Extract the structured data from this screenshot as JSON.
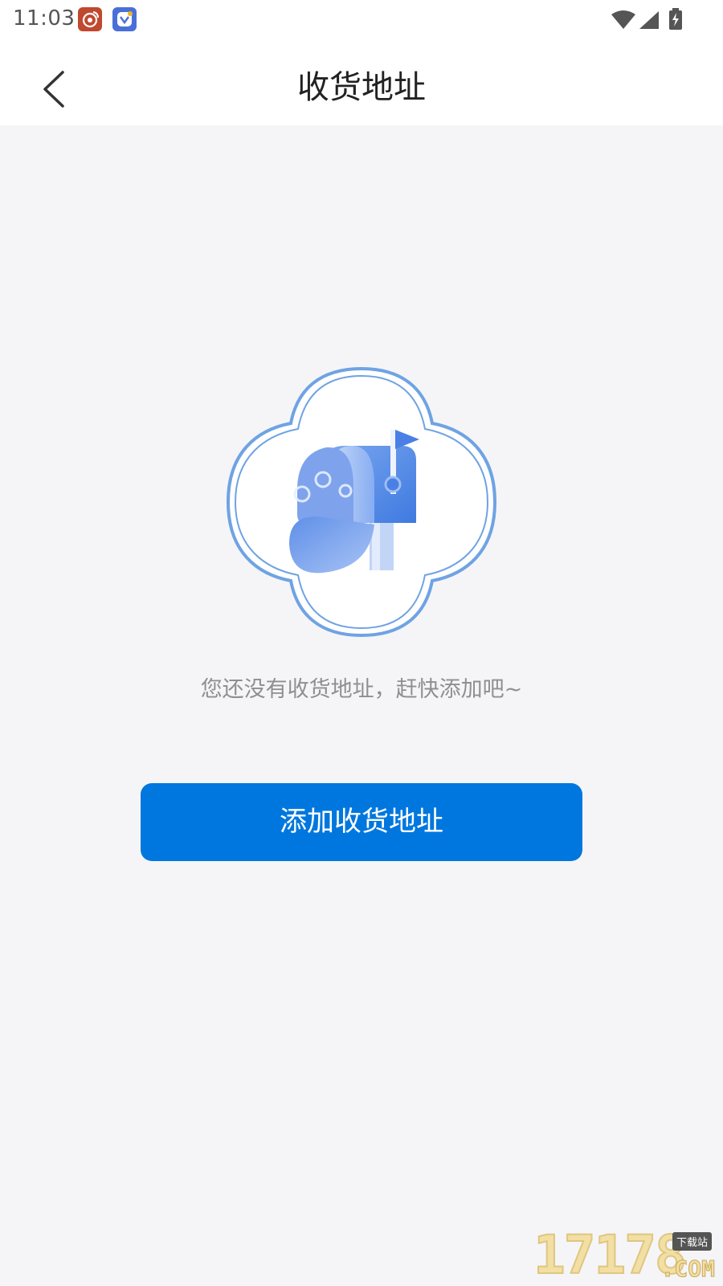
{
  "status_bar": {
    "time": "11:03",
    "notification_icons": [
      "weibo-icon",
      "app-badge-icon"
    ],
    "indicator_icons": [
      "wifi-icon",
      "cell-signal-icon",
      "battery-charging-icon"
    ]
  },
  "nav": {
    "back_icon": "chevron-left-icon",
    "title": "收货地址"
  },
  "empty_state": {
    "illustration": "mailbox-icon",
    "message": "您还没有收货地址，赶快添加吧~"
  },
  "actions": {
    "add_address_label": "添加收货地址"
  },
  "watermark": {
    "digits": "17178",
    "tag": "下载站",
    "suffix": ".COM"
  },
  "colors": {
    "background": "#f5f5f8",
    "primary": "#0077de",
    "illustration_blue": "#5b8fe8",
    "illustration_outline": "#6fa3e3"
  }
}
